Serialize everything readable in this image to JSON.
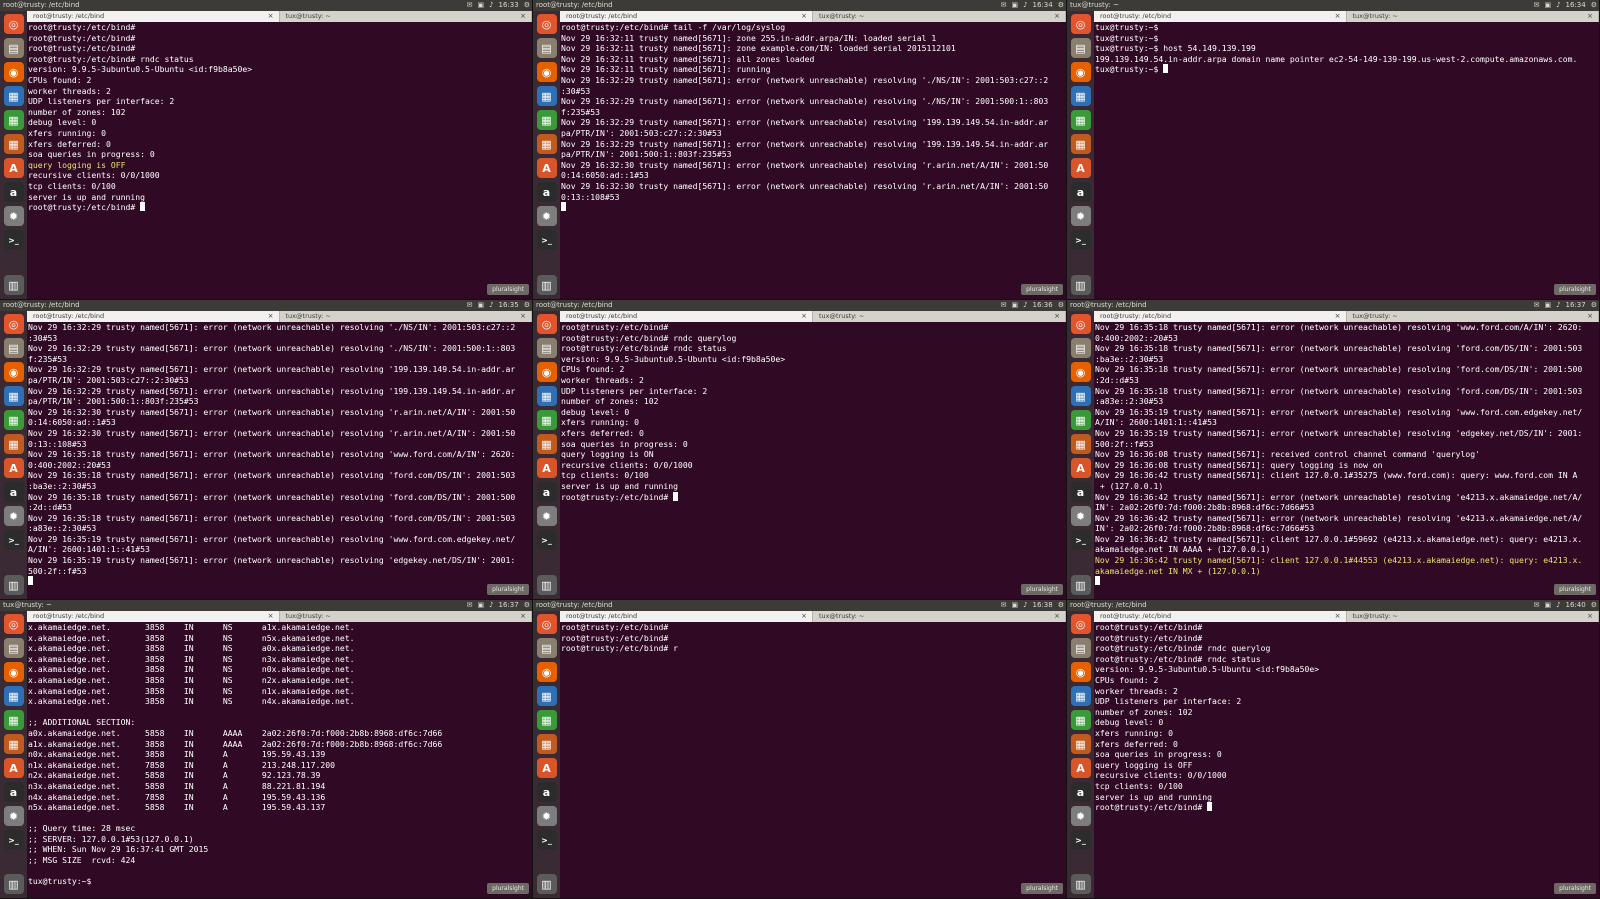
{
  "panels": [
    {
      "topbar_title": "root@trusty: /etc/bind",
      "clock": "16:33",
      "tabs": [
        "root@trusty: /etc/bind",
        "tux@trusty: ~"
      ],
      "lines": [
        "root@trusty:/etc/bind#",
        "root@trusty:/etc/bind#",
        "root@trusty:/etc/bind#",
        "root@trusty:/etc/bind# rndc status",
        "version: 9.9.5-3ubuntu0.5-Ubuntu <id:f9b8a50e>",
        "CPUs found: 2",
        "worker threads: 2",
        "UDP listeners per interface: 2",
        "number of zones: 102",
        "debug level: 0",
        "xfers running: 0",
        "xfers deferred: 0",
        "soa queries in progress: 0",
        "query logging is OFF",
        "recursive clients: 0/0/1000",
        "tcp clients: 0/100",
        "server is up and running",
        "root@trusty:/etc/bind# "
      ],
      "highlight": [
        13
      ],
      "cursor": true,
      "badge": "pluralsight"
    },
    {
      "topbar_title": "root@trusty: /etc/bind",
      "clock": "16:34",
      "tabs": [
        "root@trusty: /etc/bind",
        "tux@trusty: ~"
      ],
      "lines": [
        "root@trusty:/etc/bind# tail -f /var/log/syslog",
        "Nov 29 16:32:11 trusty named[5671]: zone 255.in-addr.arpa/IN: loaded serial 1",
        "Nov 29 16:32:11 trusty named[5671]: zone example.com/IN: loaded serial 2015112101",
        "Nov 29 16:32:11 trusty named[5671]: all zones loaded",
        "Nov 29 16:32:11 trusty named[5671]: running",
        "Nov 29 16:32:29 trusty named[5671]: error (network unreachable) resolving './NS/IN': 2001:503:c27::2",
        ":30#53",
        "Nov 29 16:32:29 trusty named[5671]: error (network unreachable) resolving './NS/IN': 2001:500:1::803",
        "f:235#53",
        "Nov 29 16:32:29 trusty named[5671]: error (network unreachable) resolving '199.139.149.54.in-addr.ar",
        "pa/PTR/IN': 2001:503:c27::2:30#53",
        "Nov 29 16:32:29 trusty named[5671]: error (network unreachable) resolving '199.139.149.54.in-addr.ar",
        "pa/PTR/IN': 2001:500:1::803f:235#53",
        "Nov 29 16:32:30 trusty named[5671]: error (network unreachable) resolving 'r.arin.net/A/IN': 2001:50",
        "0:14:6050:ad::1#53",
        "Nov 29 16:32:30 trusty named[5671]: error (network unreachable) resolving 'r.arin.net/A/IN': 2001:50",
        "0:13::108#53",
        ""
      ],
      "highlight": [],
      "cursor": true,
      "badge": "pluralsight"
    },
    {
      "topbar_title": "tux@trusty: ~",
      "clock": "16:34",
      "tabs": [
        "root@trusty: /etc/bind",
        "tux@trusty: ~"
      ],
      "lines": [
        "tux@trusty:~$",
        "tux@trusty:~$",
        "tux@trusty:~$ host 54.149.139.199",
        "199.139.149.54.in-addr.arpa domain name pointer ec2-54-149-139-199.us-west-2.compute.amazonaws.com.",
        "tux@trusty:~$ "
      ],
      "highlight": [],
      "cursor": true,
      "badge": "pluralsight"
    },
    {
      "topbar_title": "root@trusty: /etc/bind",
      "clock": "16:35",
      "tabs": [
        "root@trusty: /etc/bind",
        "tux@trusty: ~"
      ],
      "lines": [
        "Nov 29 16:32:29 trusty named[5671]: error (network unreachable) resolving './NS/IN': 2001:503:c27::2",
        ":30#53",
        "Nov 29 16:32:29 trusty named[5671]: error (network unreachable) resolving './NS/IN': 2001:500:1::803",
        "f:235#53",
        "Nov 29 16:32:29 trusty named[5671]: error (network unreachable) resolving '199.139.149.54.in-addr.ar",
        "pa/PTR/IN': 2001:503:c27::2:30#53",
        "Nov 29 16:32:29 trusty named[5671]: error (network unreachable) resolving '199.139.149.54.in-addr.ar",
        "pa/PTR/IN': 2001:500:1::803f:235#53",
        "Nov 29 16:32:30 trusty named[5671]: error (network unreachable) resolving 'r.arin.net/A/IN': 2001:50",
        "0:14:6050:ad::1#53",
        "Nov 29 16:32:30 trusty named[5671]: error (network unreachable) resolving 'r.arin.net/A/IN': 2001:50",
        "0:13::108#53",
        "Nov 29 16:35:18 trusty named[5671]: error (network unreachable) resolving 'www.ford.com/A/IN': 2620:",
        "0:400:2002::20#53",
        "Nov 29 16:35:18 trusty named[5671]: error (network unreachable) resolving 'ford.com/DS/IN': 2001:503",
        ":ba3e::2:30#53",
        "Nov 29 16:35:18 trusty named[5671]: error (network unreachable) resolving 'ford.com/DS/IN': 2001:500",
        ":2d::d#53",
        "Nov 29 16:35:18 trusty named[5671]: error (network unreachable) resolving 'ford.com/DS/IN': 2001:503",
        ":a83e::2:30#53",
        "Nov 29 16:35:19 trusty named[5671]: error (network unreachable) resolving 'www.ford.com.edgekey.net/",
        "A/IN': 2600:1401:1::41#53",
        "Nov 29 16:35:19 trusty named[5671]: error (network unreachable) resolving 'edgekey.net/DS/IN': 2001:",
        "500:2f::f#53",
        ""
      ],
      "highlight": [],
      "cursor": true,
      "badge": "pluralsight"
    },
    {
      "topbar_title": "root@trusty: /etc/bind",
      "clock": "16:36",
      "tabs": [
        "root@trusty: /etc/bind",
        "tux@trusty: ~"
      ],
      "lines": [
        "root@trusty:/etc/bind#",
        "root@trusty:/etc/bind# rndc querylog",
        "root@trusty:/etc/bind# rndc status",
        "version: 9.9.5-3ubuntu0.5-Ubuntu <id:f9b8a50e>",
        "CPUs found: 2",
        "worker threads: 2",
        "UDP listeners per interface: 2",
        "number of zones: 102",
        "debug level: 0",
        "xfers running: 0",
        "xfers deferred: 0",
        "soa queries in progress: 0",
        "query logging is ON",
        "recursive clients: 0/0/1000",
        "tcp clients: 0/100",
        "server is up and running",
        "root@trusty:/etc/bind# "
      ],
      "highlight": [],
      "cursor": true,
      "badge": "pluralsight"
    },
    {
      "topbar_title": "root@trusty: /etc/bind",
      "clock": "16:37",
      "tabs": [
        "root@trusty: /etc/bind",
        "tux@trusty: ~"
      ],
      "lines": [
        "Nov 29 16:35:18 trusty named[5671]: error (network unreachable) resolving 'www.ford.com/A/IN': 2620:",
        "0:400:2002::20#53",
        "Nov 29 16:35:18 trusty named[5671]: error (network unreachable) resolving 'ford.com/DS/IN': 2001:503",
        ":ba3e::2:30#53",
        "Nov 29 16:35:18 trusty named[5671]: error (network unreachable) resolving 'ford.com/DS/IN': 2001:500",
        ":2d::d#53",
        "Nov 29 16:35:18 trusty named[5671]: error (network unreachable) resolving 'ford.com/DS/IN': 2001:503",
        ":a83e::2:30#53",
        "Nov 29 16:35:19 trusty named[5671]: error (network unreachable) resolving 'www.ford.com.edgekey.net/",
        "A/IN': 2600:1401:1::41#53",
        "Nov 29 16:35:19 trusty named[5671]: error (network unreachable) resolving 'edgekey.net/DS/IN': 2001:",
        "500:2f::f#53",
        "Nov 29 16:36:08 trusty named[5671]: received control channel command 'querylog'",
        "Nov 29 16:36:08 trusty named[5671]: query logging is now on",
        "Nov 29 16:36:42 trusty named[5671]: client 127.0.0.1#35275 (www.ford.com): query: www.ford.com IN A",
        " + (127.0.0.1)",
        "Nov 29 16:36:42 trusty named[5671]: error (network unreachable) resolving 'e4213.x.akamaiedge.net/A/",
        "IN': 2a02:26f0:7d:f000:2b8b:8968:df6c:7d66#53",
        "Nov 29 16:36:42 trusty named[5671]: error (network unreachable) resolving 'e4213.x.akamaiedge.net/A/",
        "IN': 2a02:26f0:7d:f000:2b8b:8968:df6c:7d66#53",
        "Nov 29 16:36:42 trusty named[5671]: client 127.0.0.1#59692 (e4213.x.akamaiedge.net): query: e4213.x.",
        "akamaiedge.net IN AAAA + (127.0.0.1)",
        "Nov 29 16:36:42 trusty named[5671]: client 127.0.0.1#44553 (e4213.x.akamaiedge.net): query: e4213.x.",
        "akamaiedge.net IN MX + (127.0.0.1)",
        ""
      ],
      "highlight": [
        22,
        23
      ],
      "cursor": true,
      "badge": "pluralsight"
    },
    {
      "topbar_title": "tux@trusty: ~",
      "clock": "16:37",
      "tabs": [
        "root@trusty: /etc/bind",
        "tux@trusty: ~"
      ],
      "lines": [
        "x.akamaiedge.net.       3858    IN      NS      a1x.akamaiedge.net.",
        "x.akamaiedge.net.       3858    IN      NS      n5x.akamaiedge.net.",
        "x.akamaiedge.net.       3858    IN      NS      a0x.akamaiedge.net.",
        "x.akamaiedge.net.       3858    IN      NS      n3x.akamaiedge.net.",
        "x.akamaiedge.net.       3858    IN      NS      n0x.akamaiedge.net.",
        "x.akamaiedge.net.       3858    IN      NS      n2x.akamaiedge.net.",
        "x.akamaiedge.net.       3858    IN      NS      n1x.akamaiedge.net.",
        "x.akamaiedge.net.       3858    IN      NS      n4x.akamaiedge.net.",
        "",
        ";; ADDITIONAL SECTION:",
        "a0x.akamaiedge.net.     5858    IN      AAAA    2a02:26f0:7d:f000:2b8b:8968:df6c:7d66",
        "a1x.akamaiedge.net.     3858    IN      AAAA    2a02:26f0:7d:f000:2b8b:8968:df6c:7d66",
        "n0x.akamaiedge.net.     3858    IN      A       195.59.43.139",
        "n1x.akamaiedge.net.     7858    IN      A       213.248.117.200",
        "n2x.akamaiedge.net.     5858    IN      A       92.123.78.39",
        "n3x.akamaiedge.net.     5858    IN      A       88.221.81.194",
        "n4x.akamaiedge.net.     7858    IN      A       195.59.43.136",
        "n5x.akamaiedge.net.     5858    IN      A       195.59.43.137",
        "",
        ";; Query time: 28 msec",
        ";; SERVER: 127.0.0.1#53(127.0.0.1)",
        ";; WHEN: Sun Nov 29 16:37:41 GMT 2015",
        ";; MSG SIZE  rcvd: 424",
        "",
        "tux@trusty:~$"
      ],
      "highlight": [],
      "cursor": false,
      "badge": "pluralsight"
    },
    {
      "topbar_title": "root@trusty: /etc/bind",
      "clock": "16:38",
      "tabs": [
        "root@trusty: /etc/bind",
        "tux@trusty: ~"
      ],
      "lines": [
        "root@trusty:/etc/bind#",
        "root@trusty:/etc/bind#",
        "root@trusty:/etc/bind# r"
      ],
      "highlight": [],
      "cursor": false,
      "badge": "pluralsight"
    },
    {
      "topbar_title": "root@trusty: /etc/bind",
      "clock": "16:40",
      "tabs": [
        "root@trusty: /etc/bind",
        "tux@trusty: ~"
      ],
      "lines": [
        "root@trusty:/etc/bind#",
        "root@trusty:/etc/bind#",
        "root@trusty:/etc/bind# rndc querylog",
        "root@trusty:/etc/bind# rndc status",
        "version: 9.9.5-3ubuntu0.5-Ubuntu <id:f9b8a50e>",
        "CPUs found: 2",
        "worker threads: 2",
        "UDP listeners per interface: 2",
        "number of zones: 102",
        "debug level: 0",
        "xfers running: 0",
        "xfers deferred: 0",
        "soa queries in progress: 0",
        "query logging is OFF",
        "recursive clients: 0/0/1000",
        "tcp clients: 0/100",
        "server is up and running",
        "root@trusty:/etc/bind# "
      ],
      "highlight": [],
      "cursor": true,
      "badge": "pluralsight"
    }
  ],
  "launcher_icons": [
    {
      "name": "ubuntu-dash-icon",
      "glyph": "◎",
      "color": "#e2552c"
    },
    {
      "name": "files-icon",
      "glyph": "▤",
      "color": "#8a7f6f"
    },
    {
      "name": "firefox-icon",
      "glyph": "◉",
      "color": "#e66000"
    },
    {
      "name": "writer-icon",
      "glyph": "▦",
      "color": "#2f6fb5"
    },
    {
      "name": "calc-icon",
      "glyph": "▦",
      "color": "#3a9a3a"
    },
    {
      "name": "impress-icon",
      "glyph": "▦",
      "color": "#c05a1e"
    },
    {
      "name": "software-center-icon",
      "glyph": "A",
      "color": "#d8552a"
    },
    {
      "name": "amazon-icon",
      "glyph": "a",
      "color": "#2b2b2b"
    },
    {
      "name": "settings-icon",
      "glyph": "✹",
      "color": "#7d7d7d"
    },
    {
      "name": "terminal-icon",
      "glyph": ">_",
      "color": "#2c2c2c"
    }
  ],
  "trash_icon": {
    "name": "trash-icon",
    "glyph": "▥"
  },
  "tray_icons": [
    "✉",
    "▣",
    "♪",
    "⚙"
  ]
}
